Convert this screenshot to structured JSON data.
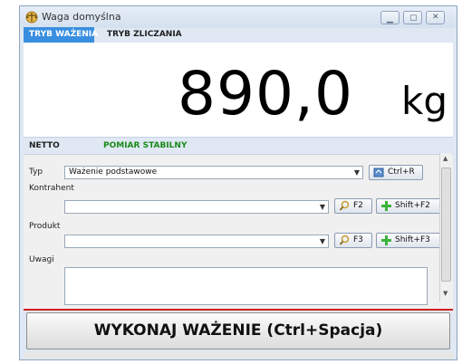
{
  "window": {
    "title": "Waga domyślna",
    "icon": "scale-icon"
  },
  "tabs": [
    {
      "label": "TRYB WAŻENIA",
      "active": true
    },
    {
      "label": "TRYB ZLICZANIA",
      "active": false
    }
  ],
  "display": {
    "value": "890,0",
    "unit": "kg"
  },
  "status": {
    "netto": "NETTO",
    "stability": "POMIAR STABILNY",
    "stability_color": "#1a8a1a"
  },
  "form": {
    "typ_label": "Typ",
    "typ_value": "Ważenie podstawowe",
    "typ_button": "Ctrl+R",
    "kontrahent_label": "Kontrahent",
    "kontrahent_value": "",
    "kontrahent_search": "F2",
    "kontrahent_add": "Shift+F2",
    "produkt_label": "Produkt",
    "produkt_value": "",
    "produkt_search": "F3",
    "produkt_add": "Shift+F3",
    "uwagi_label": "Uwagi",
    "uwagi_value": ""
  },
  "action": {
    "label": "WYKONAJ WAŻENIE (Ctrl+Spacja)"
  },
  "colors": {
    "tab_active": "#3a8ee0",
    "accent_red": "#d02020"
  }
}
